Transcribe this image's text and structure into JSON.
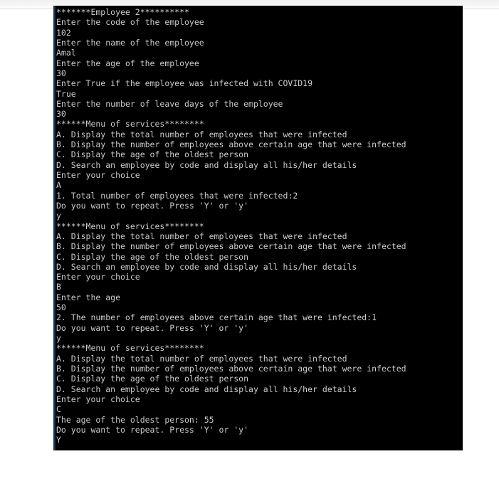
{
  "window": {
    "background_color": "#000000",
    "text_color": "#cccccc",
    "page_background_color": "#ffffff",
    "top_strip_color": "#efefef",
    "left_gutter_color": "#1c2f4a"
  },
  "console": {
    "lines": [
      "*******Employee 2**********",
      "Enter the code of the employee",
      "102",
      "Enter the name of the employee",
      "Amal",
      "Enter the age of the employee",
      "30",
      "Enter True if the employee was infected with COVID19",
      "True",
      "Enter the number of leave days of the employee",
      "30",
      "******Menu of services********",
      "A. Display the total number of employees that were infected",
      "B. Display the number of employees above certain age that were infected",
      "C. Display the age of the oldest person",
      "D. Search an employee by code and display all his/her details",
      "Enter your choice",
      "A",
      "1. Total number of employees that were infected:2",
      "Do you want to repeat. Press 'Y' or 'y'",
      "y",
      "******Menu of services********",
      "A. Display the total number of employees that were infected",
      "B. Display the number of employees above certain age that were infected",
      "C. Display the age of the oldest person",
      "D. Search an employee by code and display all his/her details",
      "Enter your choice",
      "B",
      "Enter the age",
      "50",
      "2. The number of employees above certain age that were infected:1",
      "Do you want to repeat. Press 'Y' or 'y'",
      "y",
      "******Menu of services********",
      "A. Display the total number of employees that were infected",
      "B. Display the number of employees above certain age that were infected",
      "C. Display the age of the oldest person",
      "D. Search an employee by code and display all his/her details",
      "Enter your choice",
      "C",
      "The age of the oldest person: 55",
      "Do you want to repeat. Press 'Y' or 'y'",
      "Y"
    ]
  }
}
